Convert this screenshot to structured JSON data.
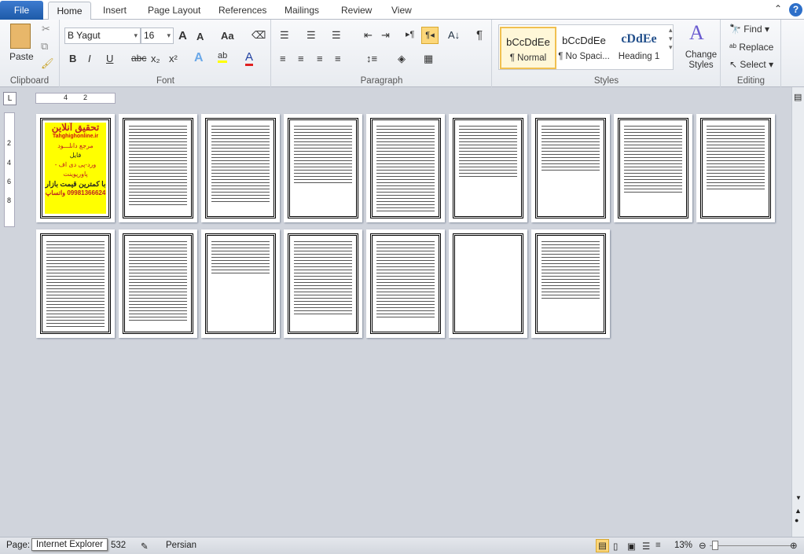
{
  "tabs": {
    "file": "File",
    "home": "Home",
    "insert": "Insert",
    "page_layout": "Page Layout",
    "references": "References",
    "mailings": "Mailings",
    "review": "Review",
    "view": "View"
  },
  "clipboard": {
    "paste": "Paste",
    "label": "Clipboard"
  },
  "font": {
    "name": "B Yagut",
    "size": "16",
    "label": "Font",
    "bold": "B",
    "italic": "I",
    "underline": "U",
    "strike": "abc",
    "sub": "x₂",
    "sup": "x²",
    "grow": "A",
    "shrink": "A",
    "case": "Aa",
    "highlight_color": "#ffff00",
    "font_color": "#e02020"
  },
  "paragraph": {
    "label": "Paragraph",
    "pilcrow": "¶"
  },
  "styles": {
    "label": "Styles",
    "items": [
      {
        "preview": "bCcDdEe",
        "name": "¶ Normal"
      },
      {
        "preview": "bCcDdEe",
        "name": "¶ No Spaci..."
      },
      {
        "preview": "cDdEe",
        "name": "Heading 1"
      }
    ],
    "change": "Change Styles"
  },
  "editing": {
    "label": "Editing",
    "find": "Find",
    "replace": "Replace",
    "select": "Select"
  },
  "ruler": {
    "marks": [
      "4",
      "2"
    ],
    "vmarks": [
      "2",
      "4",
      "6",
      "8"
    ]
  },
  "cover": {
    "title": "تحقیق آنلاین",
    "site": "Tahghighonline.ir",
    "line1": "مرجع دانلـــود",
    "line2": "فایل",
    "line3": "ورد-پی دی اف - پاورپوینت",
    "line4": "با کمترین قیمت بازار",
    "phone": "09981366624 واتساپ"
  },
  "status": {
    "page_label": "Page:",
    "tooltip": "Internet Explorer",
    "page_tail": "532",
    "language": "Persian",
    "zoom": "13%"
  }
}
